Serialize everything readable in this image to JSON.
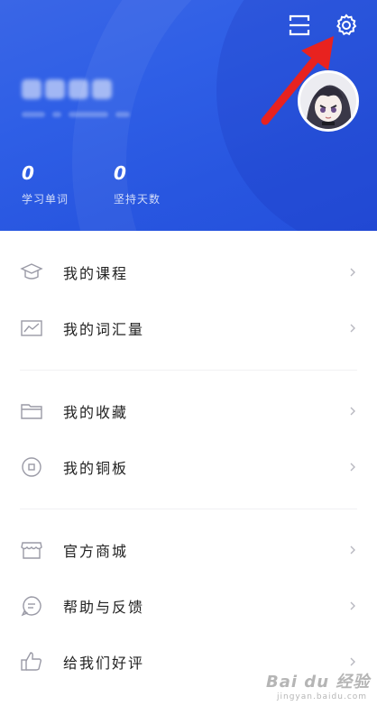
{
  "header": {
    "stats": [
      {
        "value": "0",
        "label": "学习单词"
      },
      {
        "value": "0",
        "label": "坚持天数"
      }
    ]
  },
  "menu": {
    "group1": [
      {
        "label": "我的课程",
        "icon": "graduation-cap-icon"
      },
      {
        "label": "我的词汇量",
        "icon": "chart-icon"
      }
    ],
    "group2": [
      {
        "label": "我的收藏",
        "icon": "folder-icon"
      },
      {
        "label": "我的铜板",
        "icon": "coin-icon"
      }
    ],
    "group3": [
      {
        "label": "官方商城",
        "icon": "store-icon"
      },
      {
        "label": "帮助与反馈",
        "icon": "chat-icon"
      },
      {
        "label": "给我们好评",
        "icon": "thumbs-up-icon"
      }
    ]
  },
  "watermark": {
    "line1": "Bai du 经验",
    "line2": "jingyan.baidu.com"
  },
  "colors": {
    "header_bg": "#2f5fe6",
    "arrow": "#e8221f",
    "text": "#222222",
    "icon": "#9a9aa6"
  }
}
